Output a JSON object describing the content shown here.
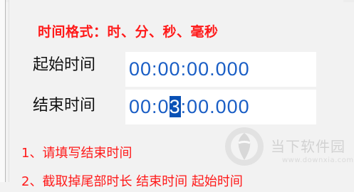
{
  "settings": {
    "format_note": "时间格式：时、分、秒、毫秒",
    "start_label": "起始时间",
    "end_label": "结束时间",
    "start_value": "00:00:00.000",
    "end_value_before": "00:0",
    "end_value_selected": "3",
    "end_value_after": ":00.000",
    "hint_1": "1、请填写结束时间",
    "hint_2": "2、截取掉尾部时长 结束时间 起始时间"
  },
  "watermark": {
    "brand": "当下软件园",
    "url": "www.downxia.com",
    "icon": "downxia-logo"
  },
  "colors": {
    "accent_red": "#ff1a1a",
    "value_blue": "#1a5ec5",
    "selection_blue": "#0a51b5"
  }
}
